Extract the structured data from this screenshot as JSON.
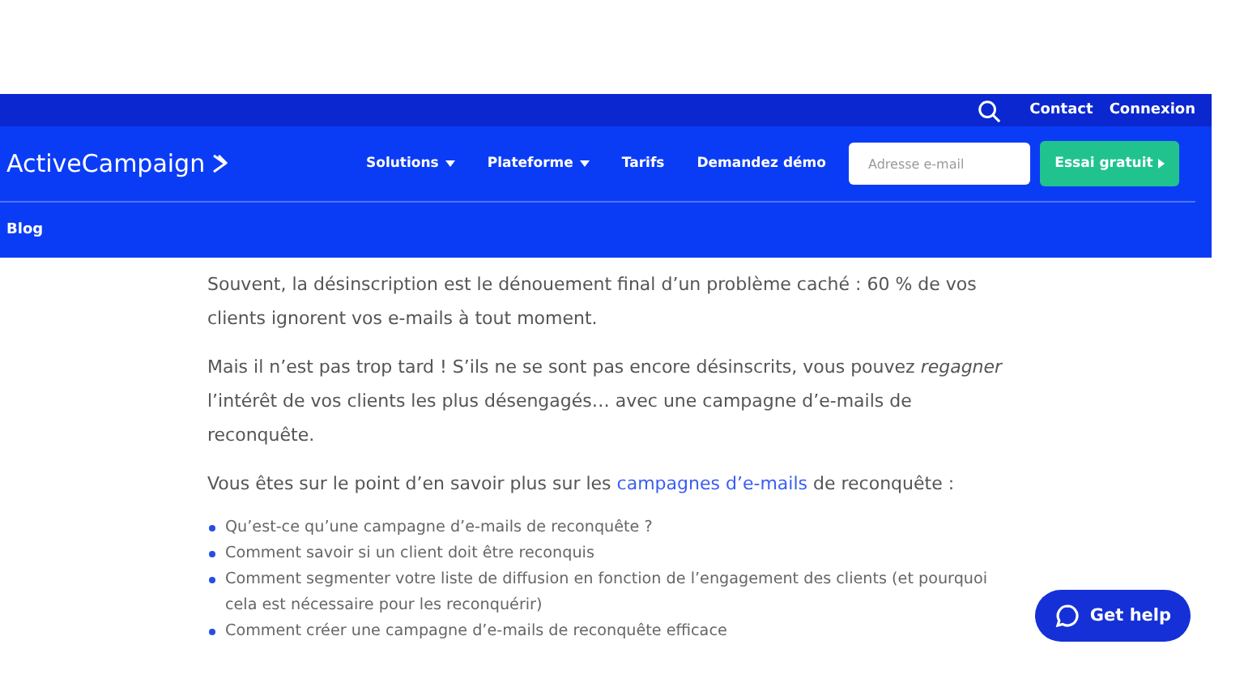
{
  "top_bar": {
    "links": [
      "Contact",
      "Connexion"
    ]
  },
  "nav": {
    "logo": "ActiveCampaign",
    "items": [
      {
        "label": "Solutions",
        "dropdown": true
      },
      {
        "label": "Plateforme",
        "dropdown": true
      },
      {
        "label": "Tarifs",
        "dropdown": false
      },
      {
        "label": "Demandez démo",
        "dropdown": false
      }
    ],
    "email": {
      "placeholder": "Adresse e-mail"
    },
    "cta": "Essai gratuit"
  },
  "subnav": {
    "label": "Blog"
  },
  "article": {
    "paragraphs": [
      {
        "text": "Souvent, la désinscription est le dénouement final d’un problème caché : 60 % de vos clients ignorent vos e-mails à tout moment."
      },
      {
        "text": "Mais il n’est pas trop tard ! S’ils ne se sont pas encore désinscrits, vous pouvez *regagner* l’intérêt de vos clients les plus désengagés… avec une campagne d’e-mails de reconquête."
      },
      {
        "text": "Vous êtes sur le point d’en savoir plus sur les",
        "link": "campagnes d’e-mails",
        "after": "de reconquête :"
      }
    ],
    "bullets": [
      "Qu’est-ce qu’une campagne d’e-mails de reconquête ?",
      "Comment savoir si un client doit être reconquis",
      "Comment segmenter votre liste de diffusion en fonction de l’engagement des clients (et pourquoi cela est nécessaire pour les reconquérir)",
      "Comment créer une campagne d’e-mails de reconquête efficace"
    ]
  },
  "help_button": {
    "label": "Get help"
  }
}
